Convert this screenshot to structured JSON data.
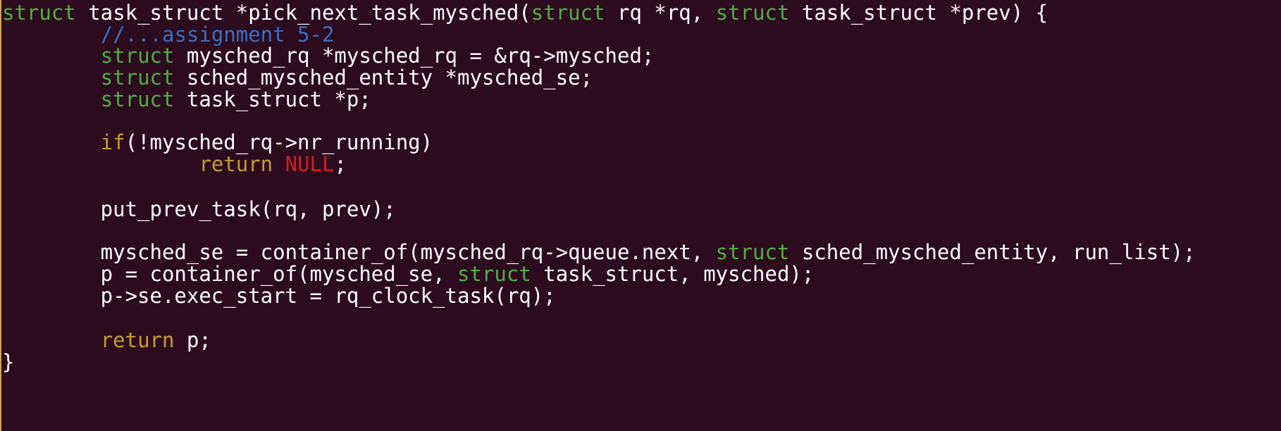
{
  "window": {
    "background": "#2c0b1f",
    "accent_bar_color": "#d1a64a"
  },
  "colors": {
    "type": "#4fb03e",
    "keyword": "#c59d2c",
    "comment": "#3a6ec4",
    "constant": "#d41f1f",
    "plain": "#ffffff"
  },
  "code": {
    "lines": [
      [
        {
          "t": "type",
          "v": "struct"
        },
        {
          "t": "plain",
          "v": " task_struct *pick_next_task_mysched("
        },
        {
          "t": "type",
          "v": "struct"
        },
        {
          "t": "plain",
          "v": " rq *rq, "
        },
        {
          "t": "type",
          "v": "struct"
        },
        {
          "t": "plain",
          "v": " task_struct *prev) {"
        }
      ],
      [
        {
          "t": "plain",
          "v": "        "
        },
        {
          "t": "comment",
          "v": "//...assignment 5-2"
        }
      ],
      [
        {
          "t": "plain",
          "v": "        "
        },
        {
          "t": "type",
          "v": "struct"
        },
        {
          "t": "plain",
          "v": " mysched_rq *mysched_rq = &rq->mysched;"
        }
      ],
      [
        {
          "t": "plain",
          "v": "        "
        },
        {
          "t": "type",
          "v": "struct"
        },
        {
          "t": "plain",
          "v": " sched_mysched_entity *mysched_se;"
        }
      ],
      [
        {
          "t": "plain",
          "v": "        "
        },
        {
          "t": "type",
          "v": "struct"
        },
        {
          "t": "plain",
          "v": " task_struct *p;"
        }
      ],
      [],
      [
        {
          "t": "plain",
          "v": "        "
        },
        {
          "t": "keyword",
          "v": "if"
        },
        {
          "t": "plain",
          "v": "(!mysched_rq->nr_running)"
        }
      ],
      [
        {
          "t": "plain",
          "v": "                "
        },
        {
          "t": "keyword",
          "v": "return"
        },
        {
          "t": "plain",
          "v": " "
        },
        {
          "t": "constant",
          "v": "NULL"
        },
        {
          "t": "plain",
          "v": ";"
        }
      ],
      [],
      [
        {
          "t": "plain",
          "v": "        put_prev_task(rq, prev);"
        }
      ],
      [],
      [
        {
          "t": "plain",
          "v": "        mysched_se = container_of(mysched_rq->queue.next, "
        },
        {
          "t": "type",
          "v": "struct"
        },
        {
          "t": "plain",
          "v": " sched_mysched_entity, run_list);"
        }
      ],
      [
        {
          "t": "plain",
          "v": "        p = container_of(mysched_se, "
        },
        {
          "t": "type",
          "v": "struct"
        },
        {
          "t": "plain",
          "v": " task_struct, mysched);"
        }
      ],
      [
        {
          "t": "plain",
          "v": "        p->se.exec_start = rq_clock_task(rq);"
        }
      ],
      [],
      [
        {
          "t": "plain",
          "v": "        "
        },
        {
          "t": "keyword",
          "v": "return"
        },
        {
          "t": "plain",
          "v": " p;"
        }
      ],
      [
        {
          "t": "plain",
          "v": "}"
        }
      ]
    ]
  }
}
